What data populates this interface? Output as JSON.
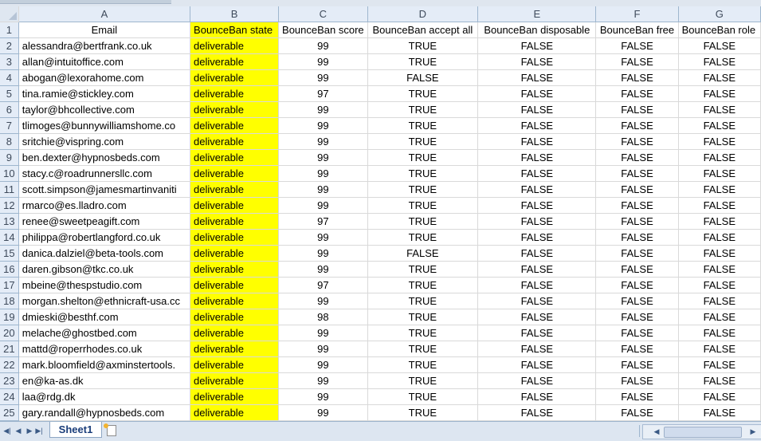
{
  "columns": [
    "A",
    "B",
    "C",
    "D",
    "E",
    "F",
    "G"
  ],
  "headers": [
    "Email",
    "BounceBan state",
    "BounceBan score",
    "BounceBan accept all",
    "BounceBan disposable",
    "BounceBan free",
    "BounceBan role"
  ],
  "rows": [
    {
      "n": "2",
      "email": "alessandra@bertfrank.co.uk",
      "state": "deliverable",
      "score": "99",
      "accept": "TRUE",
      "disposable": "FALSE",
      "free": "FALSE",
      "role": "FALSE"
    },
    {
      "n": "3",
      "email": "allan@intuitoffice.com",
      "state": "deliverable",
      "score": "99",
      "accept": "TRUE",
      "disposable": "FALSE",
      "free": "FALSE",
      "role": "FALSE"
    },
    {
      "n": "4",
      "email": "abogan@lexorahome.com",
      "state": "deliverable",
      "score": "99",
      "accept": "FALSE",
      "disposable": "FALSE",
      "free": "FALSE",
      "role": "FALSE"
    },
    {
      "n": "5",
      "email": "tina.ramie@stickley.com",
      "state": "deliverable",
      "score": "97",
      "accept": "TRUE",
      "disposable": "FALSE",
      "free": "FALSE",
      "role": "FALSE"
    },
    {
      "n": "6",
      "email": "taylor@bhcollective.com",
      "state": "deliverable",
      "score": "99",
      "accept": "TRUE",
      "disposable": "FALSE",
      "free": "FALSE",
      "role": "FALSE"
    },
    {
      "n": "7",
      "email": "tlimoges@bunnywilliamshome.co",
      "state": "deliverable",
      "score": "99",
      "accept": "TRUE",
      "disposable": "FALSE",
      "free": "FALSE",
      "role": "FALSE"
    },
    {
      "n": "8",
      "email": "sritchie@vispring.com",
      "state": "deliverable",
      "score": "99",
      "accept": "TRUE",
      "disposable": "FALSE",
      "free": "FALSE",
      "role": "FALSE"
    },
    {
      "n": "9",
      "email": "ben.dexter@hypnosbeds.com",
      "state": "deliverable",
      "score": "99",
      "accept": "TRUE",
      "disposable": "FALSE",
      "free": "FALSE",
      "role": "FALSE"
    },
    {
      "n": "10",
      "email": "stacy.c@roadrunnersllc.com",
      "state": "deliverable",
      "score": "99",
      "accept": "TRUE",
      "disposable": "FALSE",
      "free": "FALSE",
      "role": "FALSE"
    },
    {
      "n": "11",
      "email": "scott.simpson@jamesmartinvaniti",
      "state": "deliverable",
      "score": "99",
      "accept": "TRUE",
      "disposable": "FALSE",
      "free": "FALSE",
      "role": "FALSE"
    },
    {
      "n": "12",
      "email": "rmarco@es.lladro.com",
      "state": "deliverable",
      "score": "99",
      "accept": "TRUE",
      "disposable": "FALSE",
      "free": "FALSE",
      "role": "FALSE"
    },
    {
      "n": "13",
      "email": "renee@sweetpeagift.com",
      "state": "deliverable",
      "score": "97",
      "accept": "TRUE",
      "disposable": "FALSE",
      "free": "FALSE",
      "role": "FALSE"
    },
    {
      "n": "14",
      "email": "philippa@robertlangford.co.uk",
      "state": "deliverable",
      "score": "99",
      "accept": "TRUE",
      "disposable": "FALSE",
      "free": "FALSE",
      "role": "FALSE"
    },
    {
      "n": "15",
      "email": "danica.dalziel@beta-tools.com",
      "state": "deliverable",
      "score": "99",
      "accept": "FALSE",
      "disposable": "FALSE",
      "free": "FALSE",
      "role": "FALSE"
    },
    {
      "n": "16",
      "email": "daren.gibson@tkc.co.uk",
      "state": "deliverable",
      "score": "99",
      "accept": "TRUE",
      "disposable": "FALSE",
      "free": "FALSE",
      "role": "FALSE"
    },
    {
      "n": "17",
      "email": "mbeine@thespstudio.com",
      "state": "deliverable",
      "score": "97",
      "accept": "TRUE",
      "disposable": "FALSE",
      "free": "FALSE",
      "role": "FALSE"
    },
    {
      "n": "18",
      "email": "morgan.shelton@ethnicraft-usa.cc",
      "state": "deliverable",
      "score": "99",
      "accept": "TRUE",
      "disposable": "FALSE",
      "free": "FALSE",
      "role": "FALSE"
    },
    {
      "n": "19",
      "email": "dmieski@besthf.com",
      "state": "deliverable",
      "score": "98",
      "accept": "TRUE",
      "disposable": "FALSE",
      "free": "FALSE",
      "role": "FALSE"
    },
    {
      "n": "20",
      "email": "melache@ghostbed.com",
      "state": "deliverable",
      "score": "99",
      "accept": "TRUE",
      "disposable": "FALSE",
      "free": "FALSE",
      "role": "FALSE"
    },
    {
      "n": "21",
      "email": "mattd@roperrhodes.co.uk",
      "state": "deliverable",
      "score": "99",
      "accept": "TRUE",
      "disposable": "FALSE",
      "free": "FALSE",
      "role": "FALSE"
    },
    {
      "n": "22",
      "email": "mark.bloomfield@axminstertools.",
      "state": "deliverable",
      "score": "99",
      "accept": "TRUE",
      "disposable": "FALSE",
      "free": "FALSE",
      "role": "FALSE"
    },
    {
      "n": "23",
      "email": "en@ka-as.dk",
      "state": "deliverable",
      "score": "99",
      "accept": "TRUE",
      "disposable": "FALSE",
      "free": "FALSE",
      "role": "FALSE"
    },
    {
      "n": "24",
      "email": "laa@rdg.dk",
      "state": "deliverable",
      "score": "99",
      "accept": "TRUE",
      "disposable": "FALSE",
      "free": "FALSE",
      "role": "FALSE"
    },
    {
      "n": "25",
      "email": "gary.randall@hypnosbeds.com",
      "state": "deliverable",
      "score": "99",
      "accept": "TRUE",
      "disposable": "FALSE",
      "free": "FALSE",
      "role": "FALSE"
    }
  ],
  "sheet_tab": "Sheet1",
  "colors": {
    "highlight": "#ffff00",
    "header_bg": "#e4ecf7",
    "tab_text": "#1a3d7a"
  }
}
